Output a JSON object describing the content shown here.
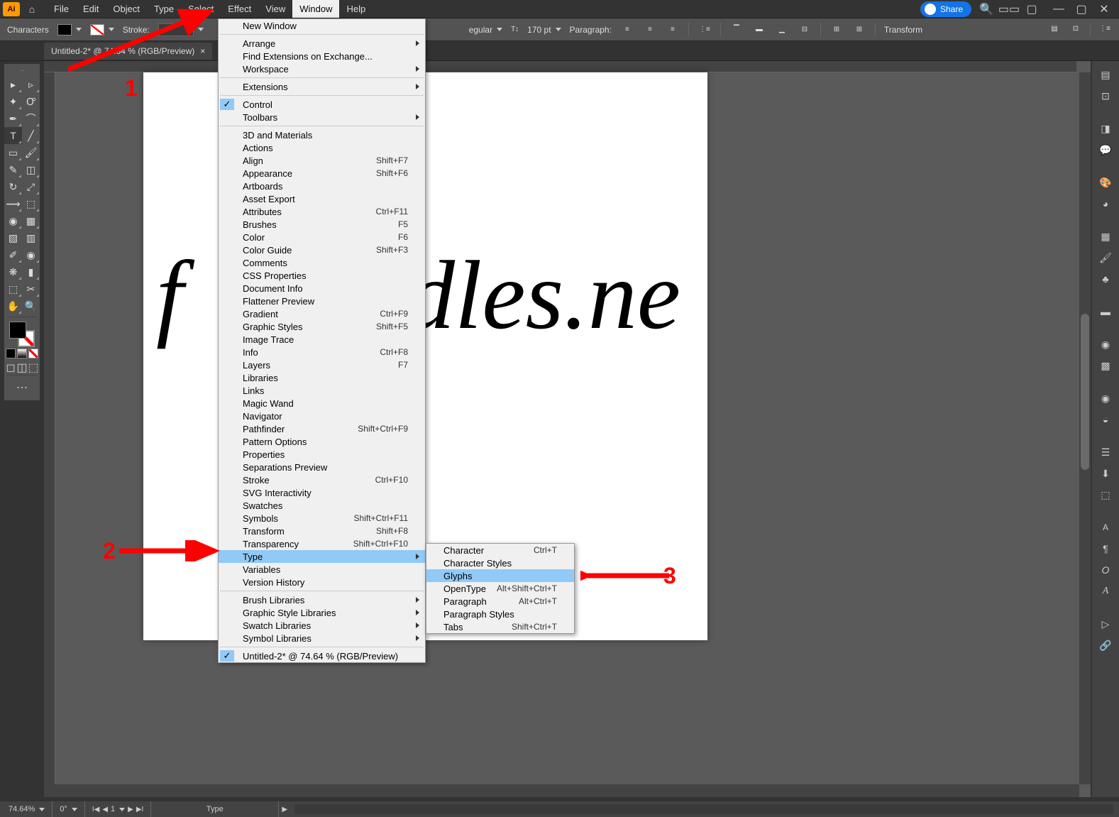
{
  "menubar": {
    "items": [
      "File",
      "Edit",
      "Object",
      "Type",
      "Select",
      "Effect",
      "View",
      "Window",
      "Help"
    ],
    "share": "Share"
  },
  "controlbar": {
    "left_label": "Characters",
    "stroke_label": "Stroke:",
    "style_label": "egular",
    "fontsize": "170 pt",
    "para_label": "Paragraph:",
    "transform": "Transform"
  },
  "tab": {
    "title": "Untitled-2* @ 74.64 % (RGB/Preview)"
  },
  "canvas": {
    "left_text": "f",
    "right_text": "dles.ne"
  },
  "window_menu": [
    {
      "label": "New Window",
      "type": "item"
    },
    {
      "type": "sep"
    },
    {
      "label": "Arrange",
      "type": "sub"
    },
    {
      "label": "Find Extensions on Exchange...",
      "type": "item"
    },
    {
      "label": "Workspace",
      "type": "sub"
    },
    {
      "type": "sep"
    },
    {
      "label": "Extensions",
      "type": "sub"
    },
    {
      "type": "sep"
    },
    {
      "label": "Control",
      "type": "check"
    },
    {
      "label": "Toolbars",
      "type": "sub"
    },
    {
      "type": "sep"
    },
    {
      "label": "3D and Materials",
      "type": "item"
    },
    {
      "label": "Actions",
      "type": "item"
    },
    {
      "label": "Align",
      "type": "item",
      "shortcut": "Shift+F7"
    },
    {
      "label": "Appearance",
      "type": "item",
      "shortcut": "Shift+F6"
    },
    {
      "label": "Artboards",
      "type": "item"
    },
    {
      "label": "Asset Export",
      "type": "item"
    },
    {
      "label": "Attributes",
      "type": "item",
      "shortcut": "Ctrl+F11"
    },
    {
      "label": "Brushes",
      "type": "item",
      "shortcut": "F5"
    },
    {
      "label": "Color",
      "type": "item",
      "shortcut": "F6"
    },
    {
      "label": "Color Guide",
      "type": "item",
      "shortcut": "Shift+F3"
    },
    {
      "label": "Comments",
      "type": "item"
    },
    {
      "label": "CSS Properties",
      "type": "item"
    },
    {
      "label": "Document Info",
      "type": "item"
    },
    {
      "label": "Flattener Preview",
      "type": "item"
    },
    {
      "label": "Gradient",
      "type": "item",
      "shortcut": "Ctrl+F9"
    },
    {
      "label": "Graphic Styles",
      "type": "item",
      "shortcut": "Shift+F5"
    },
    {
      "label": "Image Trace",
      "type": "item"
    },
    {
      "label": "Info",
      "type": "item",
      "shortcut": "Ctrl+F8"
    },
    {
      "label": "Layers",
      "type": "item",
      "shortcut": "F7"
    },
    {
      "label": "Libraries",
      "type": "item"
    },
    {
      "label": "Links",
      "type": "item"
    },
    {
      "label": "Magic Wand",
      "type": "item"
    },
    {
      "label": "Navigator",
      "type": "item"
    },
    {
      "label": "Pathfinder",
      "type": "item",
      "shortcut": "Shift+Ctrl+F9"
    },
    {
      "label": "Pattern Options",
      "type": "item"
    },
    {
      "label": "Properties",
      "type": "item"
    },
    {
      "label": "Separations Preview",
      "type": "item"
    },
    {
      "label": "Stroke",
      "type": "item",
      "shortcut": "Ctrl+F10"
    },
    {
      "label": "SVG Interactivity",
      "type": "item"
    },
    {
      "label": "Swatches",
      "type": "item"
    },
    {
      "label": "Symbols",
      "type": "item",
      "shortcut": "Shift+Ctrl+F11"
    },
    {
      "label": "Transform",
      "type": "item",
      "shortcut": "Shift+F8"
    },
    {
      "label": "Transparency",
      "type": "item",
      "shortcut": "Shift+Ctrl+F10"
    },
    {
      "label": "Type",
      "type": "sub",
      "highlight": true
    },
    {
      "label": "Variables",
      "type": "item"
    },
    {
      "label": "Version History",
      "type": "item"
    },
    {
      "type": "sep"
    },
    {
      "label": "Brush Libraries",
      "type": "sub"
    },
    {
      "label": "Graphic Style Libraries",
      "type": "sub"
    },
    {
      "label": "Swatch Libraries",
      "type": "sub"
    },
    {
      "label": "Symbol Libraries",
      "type": "sub"
    },
    {
      "type": "sep"
    },
    {
      "label": "Untitled-2* @ 74.64 % (RGB/Preview)",
      "type": "check"
    }
  ],
  "type_submenu": [
    {
      "label": "Character",
      "shortcut": "Ctrl+T"
    },
    {
      "label": "Character Styles"
    },
    {
      "label": "Glyphs",
      "highlight": true
    },
    {
      "label": "OpenType",
      "shortcut": "Alt+Shift+Ctrl+T"
    },
    {
      "label": "Paragraph",
      "shortcut": "Alt+Ctrl+T"
    },
    {
      "label": "Paragraph Styles"
    },
    {
      "label": "Tabs",
      "shortcut": "Shift+Ctrl+T"
    }
  ],
  "statusbar": {
    "zoom": "74.64%",
    "rotate": "0°",
    "artboard": "1",
    "tool": "Type"
  },
  "annotations": {
    "n1": "1",
    "n2": "2",
    "n3": "3"
  }
}
